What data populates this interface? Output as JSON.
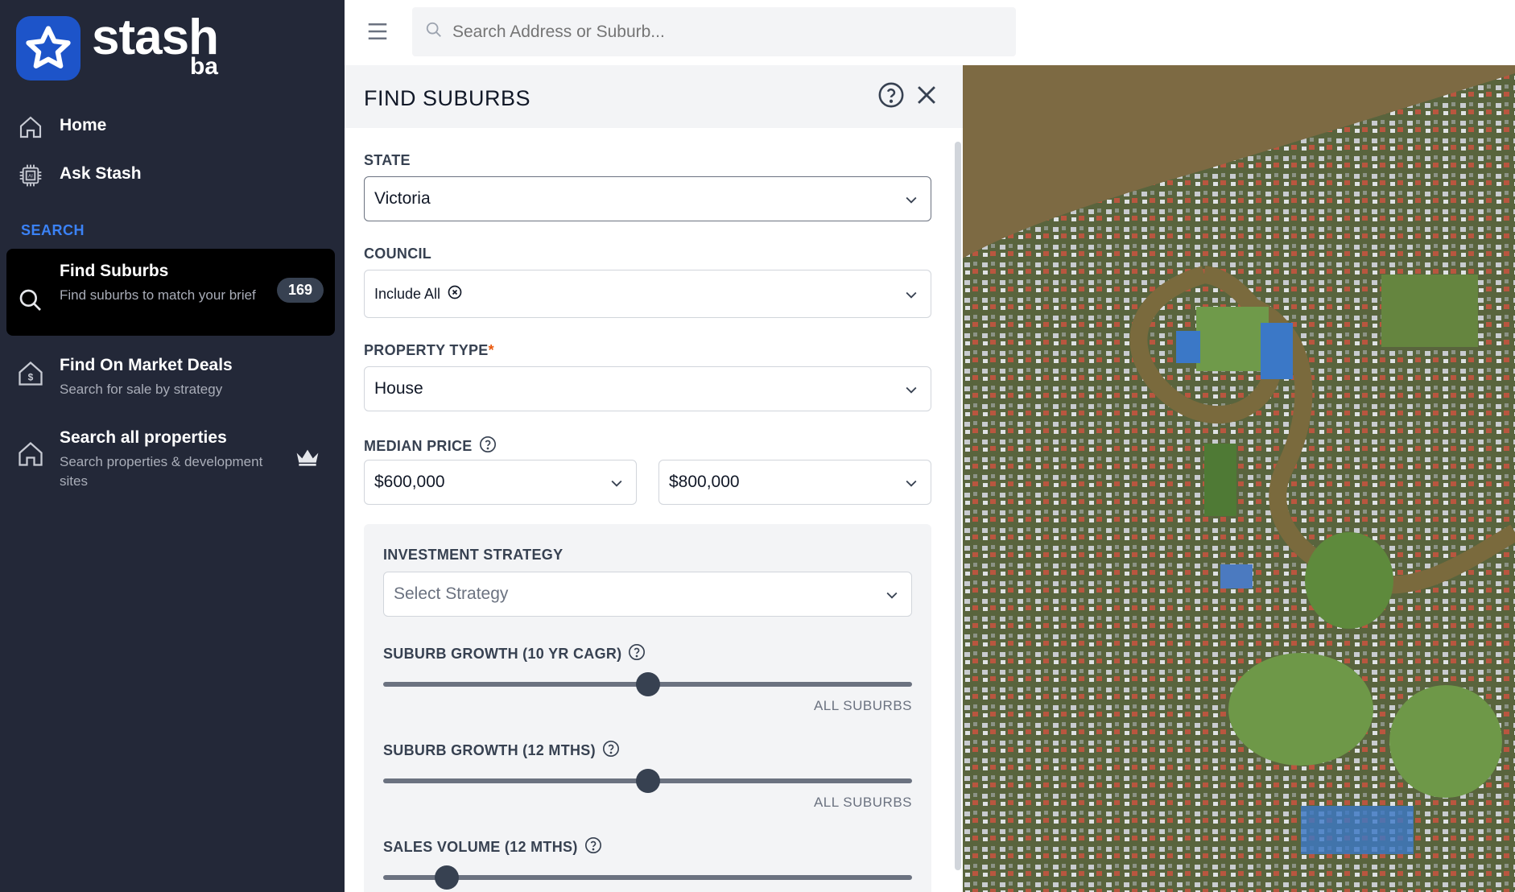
{
  "brand": {
    "name": "stash",
    "sub": "ba"
  },
  "sidebar": {
    "items": [
      {
        "title": "Home",
        "icon": "home-icon"
      },
      {
        "title": "Ask Stash",
        "icon": "ai-chip-icon"
      }
    ],
    "section_label": "SEARCH",
    "search_items": [
      {
        "title": "Find Suburbs",
        "subtitle": "Find suburbs to match your brief",
        "badge": "169",
        "icon": "search-icon",
        "active": true
      },
      {
        "title": "Find On Market Deals",
        "subtitle": "Search for sale by strategy",
        "icon": "house-dollar-icon"
      },
      {
        "title": "Search all properties",
        "subtitle": "Search properties & development sites",
        "icon": "house-icon",
        "extra_icon": "crown-icon"
      }
    ]
  },
  "topbar": {
    "search_placeholder": "Search Address or Suburb..."
  },
  "panel": {
    "title": "FIND SUBURBS",
    "state": {
      "label": "STATE",
      "value": "Victoria"
    },
    "council": {
      "label": "COUNCIL",
      "chip": "Include All"
    },
    "property_type": {
      "label": "PROPERTY TYPE",
      "required_mark": "*",
      "value": "House"
    },
    "median_price": {
      "label": "MEDIAN PRICE",
      "min": "$600,000",
      "max": "$800,000"
    },
    "investment_strategy": {
      "label": "INVESTMENT STRATEGY",
      "placeholder": "Select Strategy"
    },
    "sliders": [
      {
        "label": "SUBURB GROWTH (10 YR CAGR)",
        "caption": "ALL SUBURBS",
        "position": 0.5
      },
      {
        "label": "SUBURB GROWTH (12 MTHS)",
        "caption": "ALL SUBURBS",
        "position": 0.5
      },
      {
        "label": "SALES VOLUME (12 MTHS)",
        "caption": "",
        "position": 0.12
      }
    ]
  },
  "colors": {
    "sidebar_bg": "#232838",
    "accent": "#1d54c9",
    "section": "#3b82f6"
  }
}
